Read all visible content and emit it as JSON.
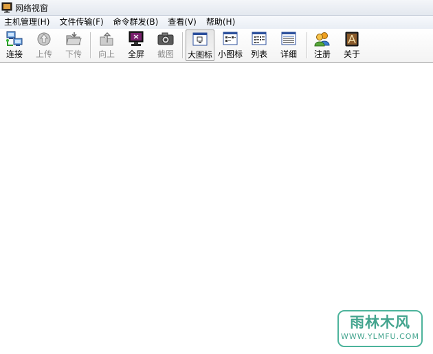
{
  "window": {
    "title": "网络视窗",
    "icon": "app-monitor-icon"
  },
  "menubar": {
    "items": [
      {
        "label": "主机管理(H)"
      },
      {
        "label": "文件传输(F)"
      },
      {
        "label": "命令群发(B)"
      },
      {
        "label": "查看(V)"
      },
      {
        "label": "帮助(H)"
      }
    ]
  },
  "toolbar": {
    "buttons": [
      {
        "id": "connect",
        "label": "连接",
        "icon": "network-computers-icon",
        "enabled": true
      },
      {
        "id": "upload",
        "label": "上传",
        "icon": "upload-icon",
        "enabled": false
      },
      {
        "id": "download",
        "label": "下传",
        "icon": "download-folder-icon",
        "enabled": false
      },
      {
        "id": "up",
        "label": "向上",
        "icon": "up-folder-icon",
        "enabled": false
      },
      {
        "id": "fullscreen",
        "label": "全屏",
        "icon": "monitor-icon",
        "enabled": true
      },
      {
        "id": "screenshot",
        "label": "截图",
        "icon": "camera-icon",
        "enabled": false
      },
      {
        "id": "large-icons",
        "label": "大图标",
        "icon": "large-icons-view-icon",
        "enabled": true,
        "pressed": true
      },
      {
        "id": "small-icons",
        "label": "小图标",
        "icon": "small-icons-view-icon",
        "enabled": true
      },
      {
        "id": "list",
        "label": "列表",
        "icon": "list-view-icon",
        "enabled": true
      },
      {
        "id": "details",
        "label": "详细",
        "icon": "details-view-icon",
        "enabled": true
      },
      {
        "id": "register",
        "label": "注册",
        "icon": "users-icon",
        "enabled": true
      },
      {
        "id": "about",
        "label": "关于",
        "icon": "about-book-icon",
        "enabled": true
      }
    ]
  },
  "watermark": {
    "logo": "雨林木风",
    "url": "WWW.YLMFU.COM"
  }
}
